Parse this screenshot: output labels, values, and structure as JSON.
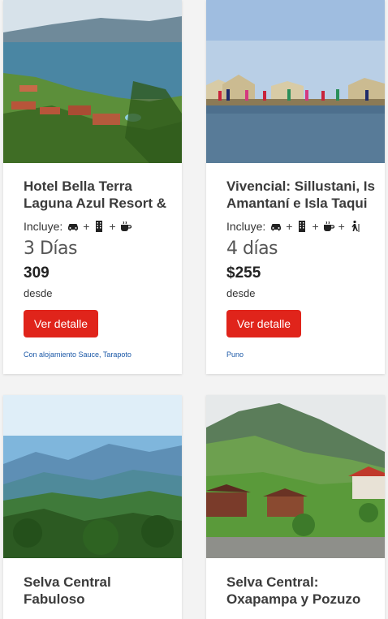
{
  "cards": [
    {
      "title_line1": "Hotel Bella Terra",
      "title_line2": "Laguna Azul Resort &",
      "includes_label": "Incluye:",
      "includes_icons": [
        "car-icon",
        "building-icon",
        "coffee-icon"
      ],
      "duration": "3 Días",
      "price": "309",
      "from_label": "desde",
      "button_label": "Ver detalle",
      "location": "Con alojamiento Sauce, Tarapoto"
    },
    {
      "title_line1": "Vivencial: Sillustani, Is",
      "title_line2": "Amantaní e Isla Taqui",
      "includes_label": "Incluye:",
      "includes_icons": [
        "car-icon",
        "building-icon",
        "coffee-icon",
        "hiking-icon"
      ],
      "duration": "4 días",
      "price": "$255",
      "from_label": "desde",
      "button_label": "Ver detalle",
      "location": "Puno"
    },
    {
      "title_line1": "Selva Central",
      "title_line2": "Fabuloso"
    },
    {
      "title_line1": "Selva Central:",
      "title_line2": "Oxapampa y Pozuzo"
    }
  ],
  "colors": {
    "button_bg": "#e0241b",
    "location_link": "#1d5aa8",
    "title_text": "#3b3b3b"
  }
}
